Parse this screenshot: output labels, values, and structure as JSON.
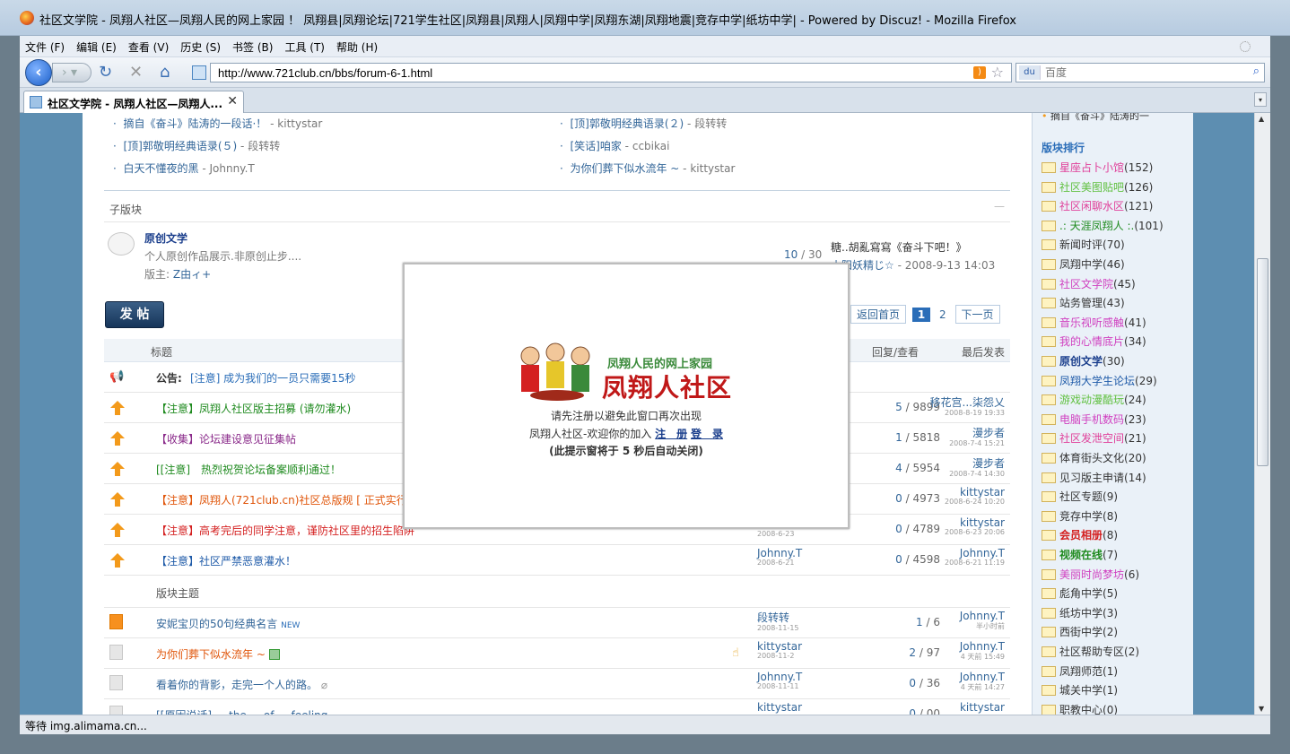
{
  "window": {
    "title": "社区文学院 - 凤翔人社区—凤翔人民的网上家园 ！ 凤翔县|凤翔论坛|721学生社区|凤翔县|凤翔人|凤翔中学|凤翔东湖|凤翔地震|竞存中学|纸坊中学| - Powered by Discuz! - Mozilla Firefox"
  },
  "menu": [
    "文件 (F)",
    "编辑 (E)",
    "查看 (V)",
    "历史 (S)",
    "书签 (B)",
    "工具 (T)",
    "帮助 (H)"
  ],
  "nav": {
    "url": "http://www.721club.cn/bbs/forum-6-1.html",
    "search_placeholder": "百度",
    "search_engine": "du"
  },
  "tab": {
    "title": "社区文学院 - 凤翔人社区—凤翔人..."
  },
  "status": "等待 img.alimama.cn...",
  "top_links": {
    "left": [
      {
        "title": "摘自《奋斗》陆涛的一段话·！",
        "author": "kittystar"
      },
      {
        "title": "[顶]郭敬明经典语录(５)",
        "author": "段转转"
      },
      {
        "title": "白天不懂夜的黑",
        "author": "Johnny.T"
      }
    ],
    "right": [
      {
        "title": "[顶]郭敬明经典语录(２)",
        "author": "段转转"
      },
      {
        "title": "[笑话]咱家",
        "author": "ccbikai"
      },
      {
        "title": "为你们葬下似水流年 ~",
        "author": "kittystar"
      }
    ]
  },
  "subforum": {
    "header": "子版块",
    "collapse": "—",
    "name": "原创文学",
    "desc": "个人原创作品展示.非原创止步....",
    "moderator_label": "版主:",
    "moderator": "Z由ィ+",
    "threads": "10",
    "sep": "/",
    "posts": "30",
    "last_title": "糖..胡亂寫寫《奋斗下吧！》",
    "last_author": "小阳妖精じ☆",
    "last_time": " - 2008-9-13 14:03"
  },
  "post_button": "发 帖",
  "pager": {
    "back": "返回首页",
    "current": "1",
    "next_page": "2",
    "next": "下一页"
  },
  "table": {
    "col_title": "标题",
    "col_replies": "回复/查看",
    "col_last": "最后发表",
    "section_label": "版块主题"
  },
  "announcement": {
    "label": "公告:",
    "title": "[注意] 成为我们的一员只需要15秒"
  },
  "sticky_rows": [
    {
      "title": "【注意】凤翔人社区版主招募 (请勿灌水)",
      "color": "#1e8a1e",
      "date": "",
      "author": "",
      "replies": "5",
      "views": "9899",
      "last_author": "移花宫...柒怨乂",
      "last_time": "2008-8-19 19:33"
    },
    {
      "title": "【收集】论坛建设意见征集帖",
      "color": "#8a2a8a",
      "date": "",
      "author": "",
      "replies": "1",
      "views": "5818",
      "last_author": "漫步者",
      "last_time": "2008-7-4 15:21"
    },
    {
      "title": "[[注意]　热烈祝贺论坛备案顺利通过！",
      "color": "#1e8a1e",
      "date": "",
      "author": "",
      "replies": "4",
      "views": "5954",
      "last_author": "漫步者",
      "last_time": "2008-7-4 14:30"
    },
    {
      "title": "【注意】凤翔人(721club.cn)社区总版规 [ 正式实行",
      "color": "#e0550a",
      "date": "",
      "author": "",
      "replies": "0",
      "views": "4973",
      "last_author": "kittystar",
      "last_time": "2008-6-24 10:20"
    },
    {
      "title": "【注意】高考完后的同学注意，谨防社区里的招生陷阱",
      "color": "#d42020",
      "date": "2008-6-23",
      "author": "",
      "replies": "0",
      "views": "4789",
      "last_author": "kittystar",
      "last_time": "2008-6-23 20:06"
    },
    {
      "title": "【注意】社区严禁恶意灌水！",
      "color": "#1e5aa8",
      "date": "2008-6-21",
      "author": "Johnny.T",
      "replies": "0",
      "views": "4598",
      "last_author": "Johnny.T",
      "last_time": "2008-6-21 11:19"
    }
  ],
  "normal_rows": [
    {
      "title": "安妮宝贝的50句经典名言",
      "badge": "NEW",
      "color": "#336699",
      "author": "段转转",
      "date": "2008-11-15",
      "replies": "1",
      "views": "6",
      "last_author": "Johnny.T",
      "last_time": "半小时前"
    },
    {
      "title": "为你们葬下似水流年 ~",
      "badge": "",
      "color": "#e0550a",
      "author": "kittystar",
      "date": "2008-11-2",
      "replies": "2",
      "views": "97",
      "last_author": "Johnny.T",
      "last_time": "4 天前 15:49"
    },
    {
      "title": "看着你的背影，走完一个人的路。",
      "badge": "",
      "color": "#336699",
      "author": "Johnny.T",
      "date": "2008-11-11",
      "replies": "0",
      "views": "36",
      "last_author": "Johnny.T",
      "last_time": "4 天前 14:27"
    },
    {
      "title": "[[原因说话] ... the ... of ... feeling ... ",
      "badge": "",
      "color": "#336699",
      "author": "kittystar",
      "date": "",
      "replies": "0",
      "views": "00",
      "last_author": "kittystar",
      "last_time": ""
    }
  ],
  "popup": {
    "logo_top": "凤翔人民的网上家园",
    "logo_main": "凤翔人社区",
    "line1": "请先注册以避免此窗口再次出现",
    "line2_prefix": "凤翔人社区-欢迎你的加入",
    "register": "注　册",
    "login": "登　录",
    "line3": "(此提示窗将于 5 秒后自动关闭)"
  },
  "sidebar": {
    "top_item": "摘自《奋斗》陆涛的一",
    "heading": "版块排行",
    "items": [
      {
        "name": "星座占卜小馆",
        "count": "(152)",
        "color": "#e0409a"
      },
      {
        "name": "社区美图贴吧",
        "count": "(126)",
        "color": "#60c040"
      },
      {
        "name": "社区闲聊水区",
        "count": "(121)",
        "color": "#e0409a"
      },
      {
        "name": ".: 天涯凤翔人 :.",
        "count": "(101)",
        "color": "#1e8a1e"
      },
      {
        "name": "新闻时评",
        "count": "(70)",
        "color": "#333333"
      },
      {
        "name": "凤翔中学",
        "count": "(46)",
        "color": "#333333"
      },
      {
        "name": "社区文学院",
        "count": "(45)",
        "color": "#d040c0"
      },
      {
        "name": "站务管理",
        "count": "(43)",
        "color": "#333333"
      },
      {
        "name": "音乐视听感触",
        "count": "(41)",
        "color": "#d040c0"
      },
      {
        "name": "我的心情底片",
        "count": "(34)",
        "color": "#d040c0"
      },
      {
        "name": "原创文学",
        "count": "(30)",
        "color": "#1a3e8c"
      },
      {
        "name": "凤翔大学生论坛",
        "count": "(29)",
        "color": "#1e5aa8"
      },
      {
        "name": "游戏动漫酷玩",
        "count": "(24)",
        "color": "#60c040"
      },
      {
        "name": "电脑手机数码",
        "count": "(23)",
        "color": "#d040c0"
      },
      {
        "name": "社区发泄空间",
        "count": "(21)",
        "color": "#e0409a"
      },
      {
        "name": "体育街头文化",
        "count": "(20)",
        "color": "#333333"
      },
      {
        "name": "见习版主申请",
        "count": "(14)",
        "color": "#333333"
      },
      {
        "name": "社区专题",
        "count": "(9)",
        "color": "#333333"
      },
      {
        "name": "竞存中学",
        "count": "(8)",
        "color": "#333333"
      },
      {
        "name": "会员相册",
        "count": "(8)",
        "color": "#d42020"
      },
      {
        "name": "视频在线",
        "count": "(7)",
        "color": "#1e8a1e"
      },
      {
        "name": "美丽时尚梦坊",
        "count": "(6)",
        "color": "#d040c0"
      },
      {
        "name": "彪角中学",
        "count": "(5)",
        "color": "#333333"
      },
      {
        "name": "纸坊中学",
        "count": "(3)",
        "color": "#333333"
      },
      {
        "name": "西街中学",
        "count": "(2)",
        "color": "#333333"
      },
      {
        "name": "社区帮助专区",
        "count": "(2)",
        "color": "#333333"
      },
      {
        "name": "凤翔师范",
        "count": "(1)",
        "color": "#333333"
      },
      {
        "name": "城关中学",
        "count": "(1)",
        "color": "#333333"
      },
      {
        "name": "职教中心",
        "count": "(0)",
        "color": "#333333"
      }
    ]
  }
}
